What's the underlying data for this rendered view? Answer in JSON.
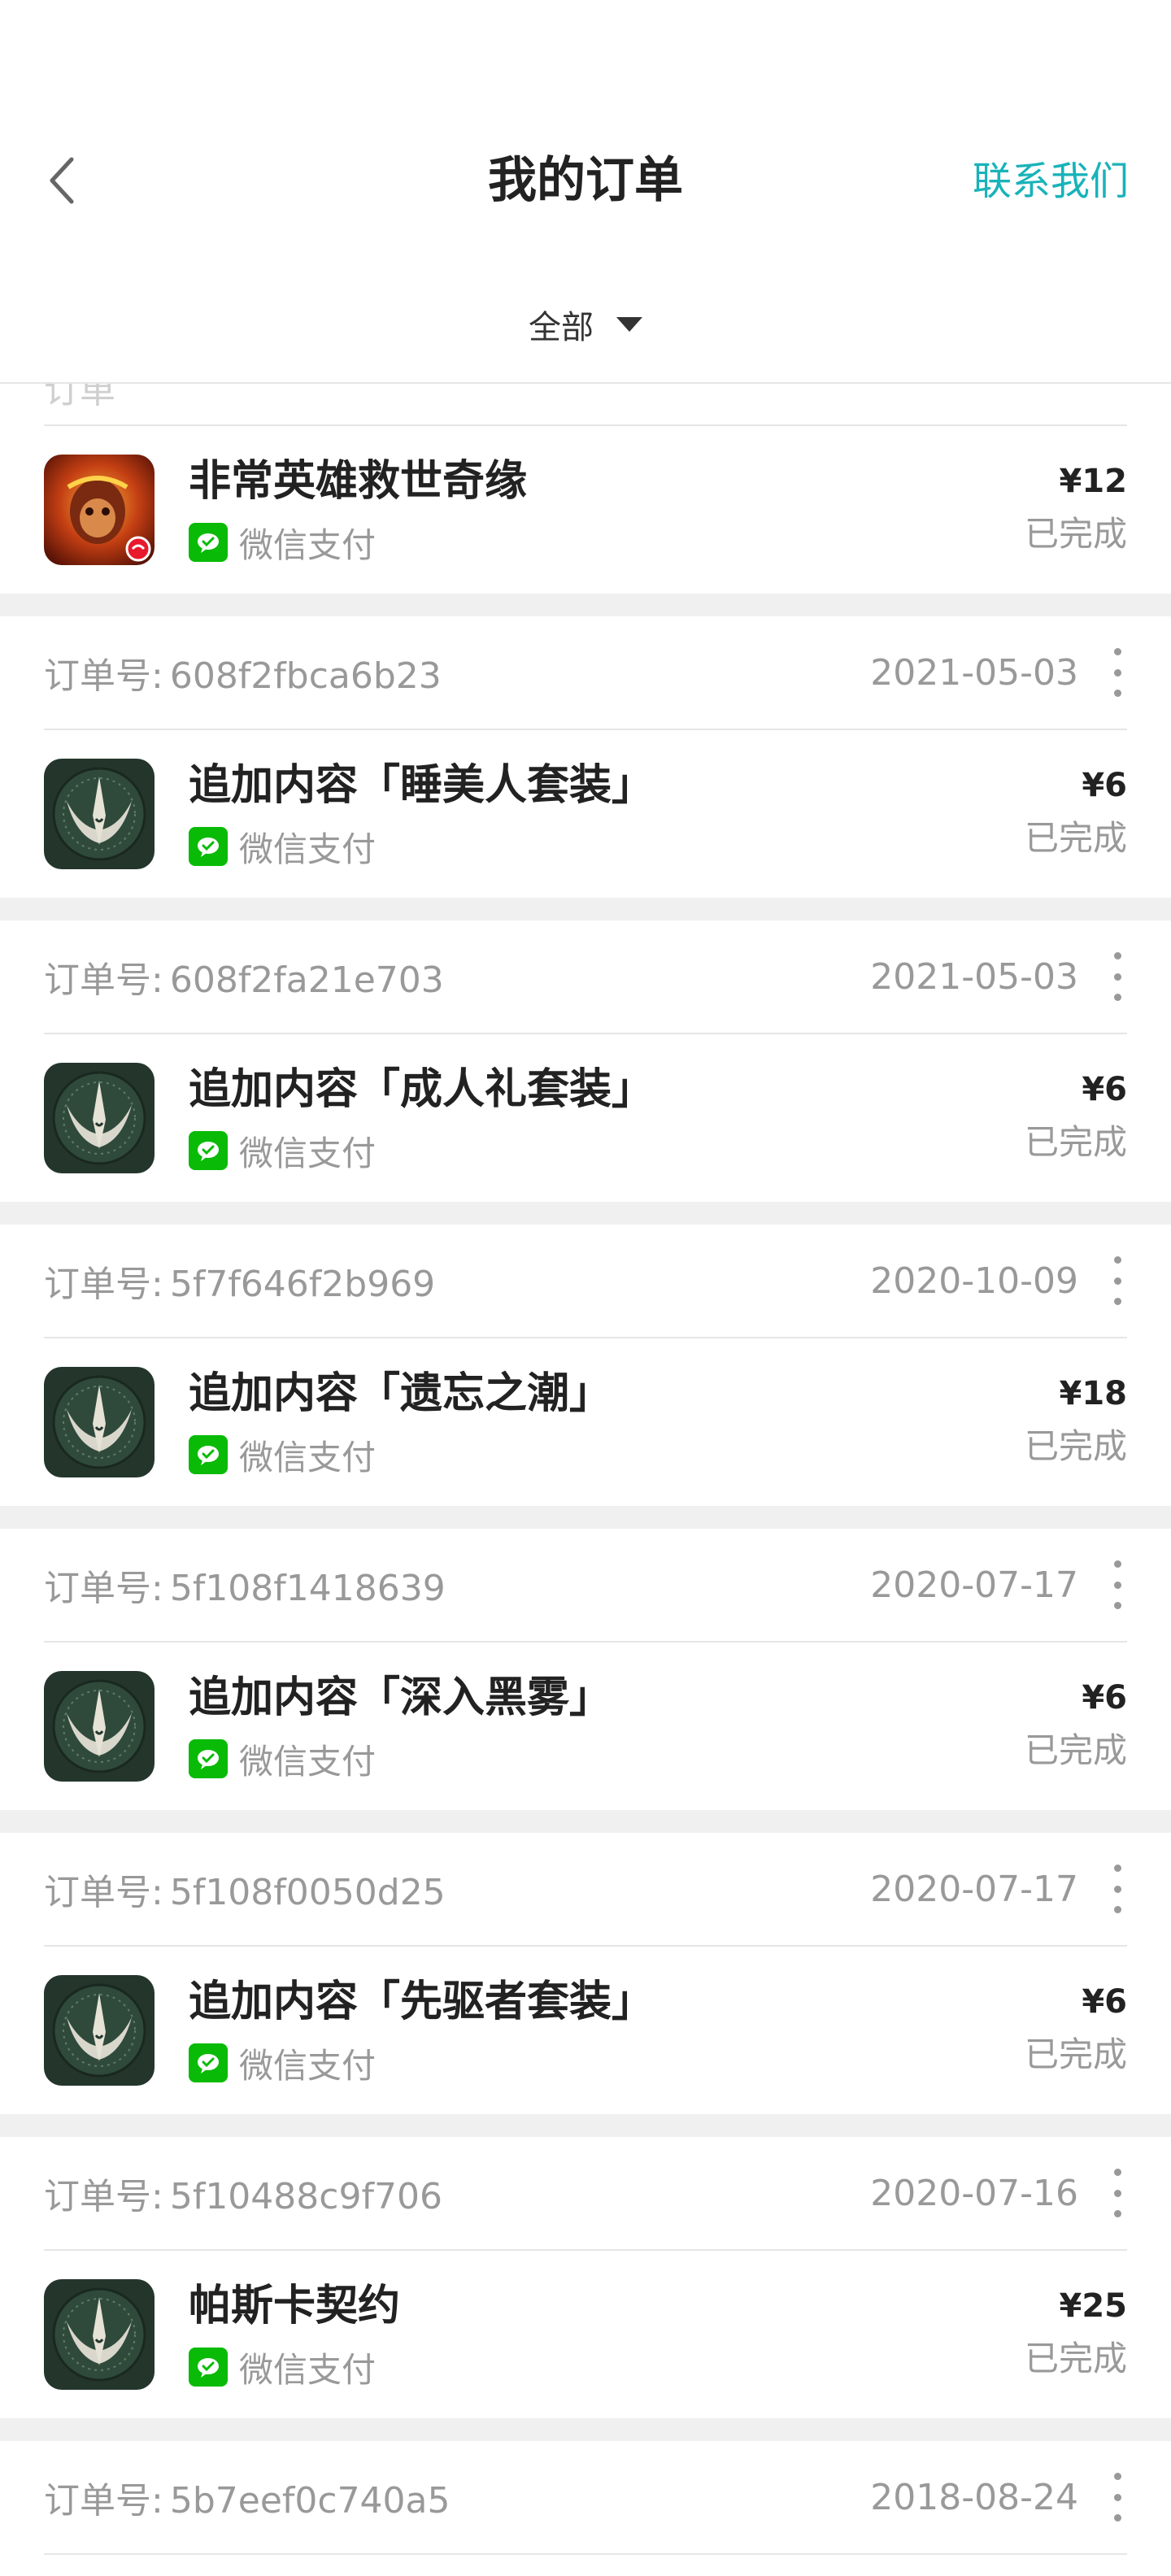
{
  "header": {
    "title": "我的订单",
    "contact_label": "联系我们",
    "filter_label": "全部"
  },
  "colors": {
    "accent": "#19b3b9",
    "wechat_green": "#09bb07",
    "muted_text": "#999999",
    "divider": "#f0f0f0"
  },
  "first_order": {
    "product": "非常英雄救世奇缘",
    "payment": "微信支付",
    "price": "¥12",
    "status": "已完成",
    "icon": "monkey-king-game-icon"
  },
  "orders": [
    {
      "order_label": "订单号:",
      "order_no": "608f2fbca6b23",
      "date": "2021-05-03",
      "product": "追加内容「睡美人套装」",
      "payment": "微信支付",
      "price": "¥6",
      "status": "已完成",
      "icon": "emblem-game-icon"
    },
    {
      "order_label": "订单号:",
      "order_no": "608f2fa21e703",
      "date": "2021-05-03",
      "product": "追加内容「成人礼套装」",
      "payment": "微信支付",
      "price": "¥6",
      "status": "已完成",
      "icon": "emblem-game-icon"
    },
    {
      "order_label": "订单号:",
      "order_no": "5f7f646f2b969",
      "date": "2020-10-09",
      "product": "追加内容「遗忘之潮」",
      "payment": "微信支付",
      "price": "¥18",
      "status": "已完成",
      "icon": "emblem-game-icon"
    },
    {
      "order_label": "订单号:",
      "order_no": "5f108f1418639",
      "date": "2020-07-17",
      "product": "追加内容「深入黑雾」",
      "payment": "微信支付",
      "price": "¥6",
      "status": "已完成",
      "icon": "emblem-game-icon"
    },
    {
      "order_label": "订单号:",
      "order_no": "5f108f0050d25",
      "date": "2020-07-17",
      "product": "追加内容「先驱者套装」",
      "payment": "微信支付",
      "price": "¥6",
      "status": "已完成",
      "icon": "emblem-game-icon"
    },
    {
      "order_label": "订单号:",
      "order_no": "5f10488c9f706",
      "date": "2020-07-16",
      "product": "帕斯卡契约",
      "payment": "微信支付",
      "price": "¥25",
      "status": "已完成",
      "icon": "emblem-game-icon"
    }
  ],
  "last_order": {
    "order_label": "订单号:",
    "order_no": "5b7eef0c740a5",
    "date": "2018-08-24"
  }
}
